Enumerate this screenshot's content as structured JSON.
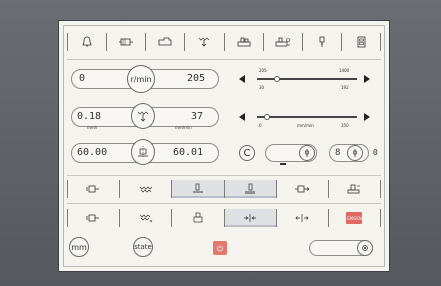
{
  "toolbar_top": {
    "items": [
      {
        "icon": "bell-icon"
      },
      {
        "icon": "motor-icon"
      },
      {
        "icon": "clamp-icon"
      },
      {
        "icon": "feed-icon"
      },
      {
        "icon": "machine-icon"
      },
      {
        "icon": "machine-settings-icon"
      },
      {
        "icon": "tool-icon"
      },
      {
        "icon": "document-icon"
      }
    ]
  },
  "spindle": {
    "left_value": "0",
    "unit": "r/min",
    "right_value": "205",
    "slider": {
      "min_label": "30",
      "max_label": "192",
      "top_left_label": "205",
      "top_right_label": "1400",
      "level": 0.2
    }
  },
  "feed": {
    "left_value": "0.18",
    "left_unit": "mm/r",
    "right_value": "37",
    "right_unit": "mm/min",
    "slider": {
      "min_label": "0",
      "mid_label": "mm/min",
      "max_label": "350",
      "level": 0.1
    }
  },
  "position": {
    "left_value": "60.00",
    "right_value": "60.01",
    "c_label": "C",
    "counter_value": "8",
    "counter_extra": "0"
  },
  "toolbar_mid": {
    "items": [
      {
        "icon": "align-left-icon",
        "pressed": false
      },
      {
        "icon": "chip-icon",
        "pressed": false
      },
      {
        "icon": "column-left-icon",
        "pressed": true
      },
      {
        "icon": "column-right-icon",
        "pressed": true
      },
      {
        "icon": "feed-right-icon",
        "pressed": false
      },
      {
        "icon": "machine-right-icon",
        "pressed": false
      }
    ]
  },
  "toolbar_low": {
    "items": [
      {
        "icon": "align-left-icon",
        "pressed": false
      },
      {
        "icon": "chip-down-icon",
        "pressed": false
      },
      {
        "icon": "clamp-small-icon",
        "pressed": false
      },
      {
        "icon": "move-in-icon",
        "pressed": true
      },
      {
        "icon": "move-out-icon",
        "pressed": false
      },
      {
        "icon": "emergency-icon",
        "pressed": false,
        "alert_text": "EMGEN"
      }
    ]
  },
  "footer": {
    "mm_label": "mm",
    "state_label": "state"
  },
  "colors": {
    "alert": "#e06a63",
    "power": "#e2776c",
    "screen_bg": "#f4f3ee"
  }
}
